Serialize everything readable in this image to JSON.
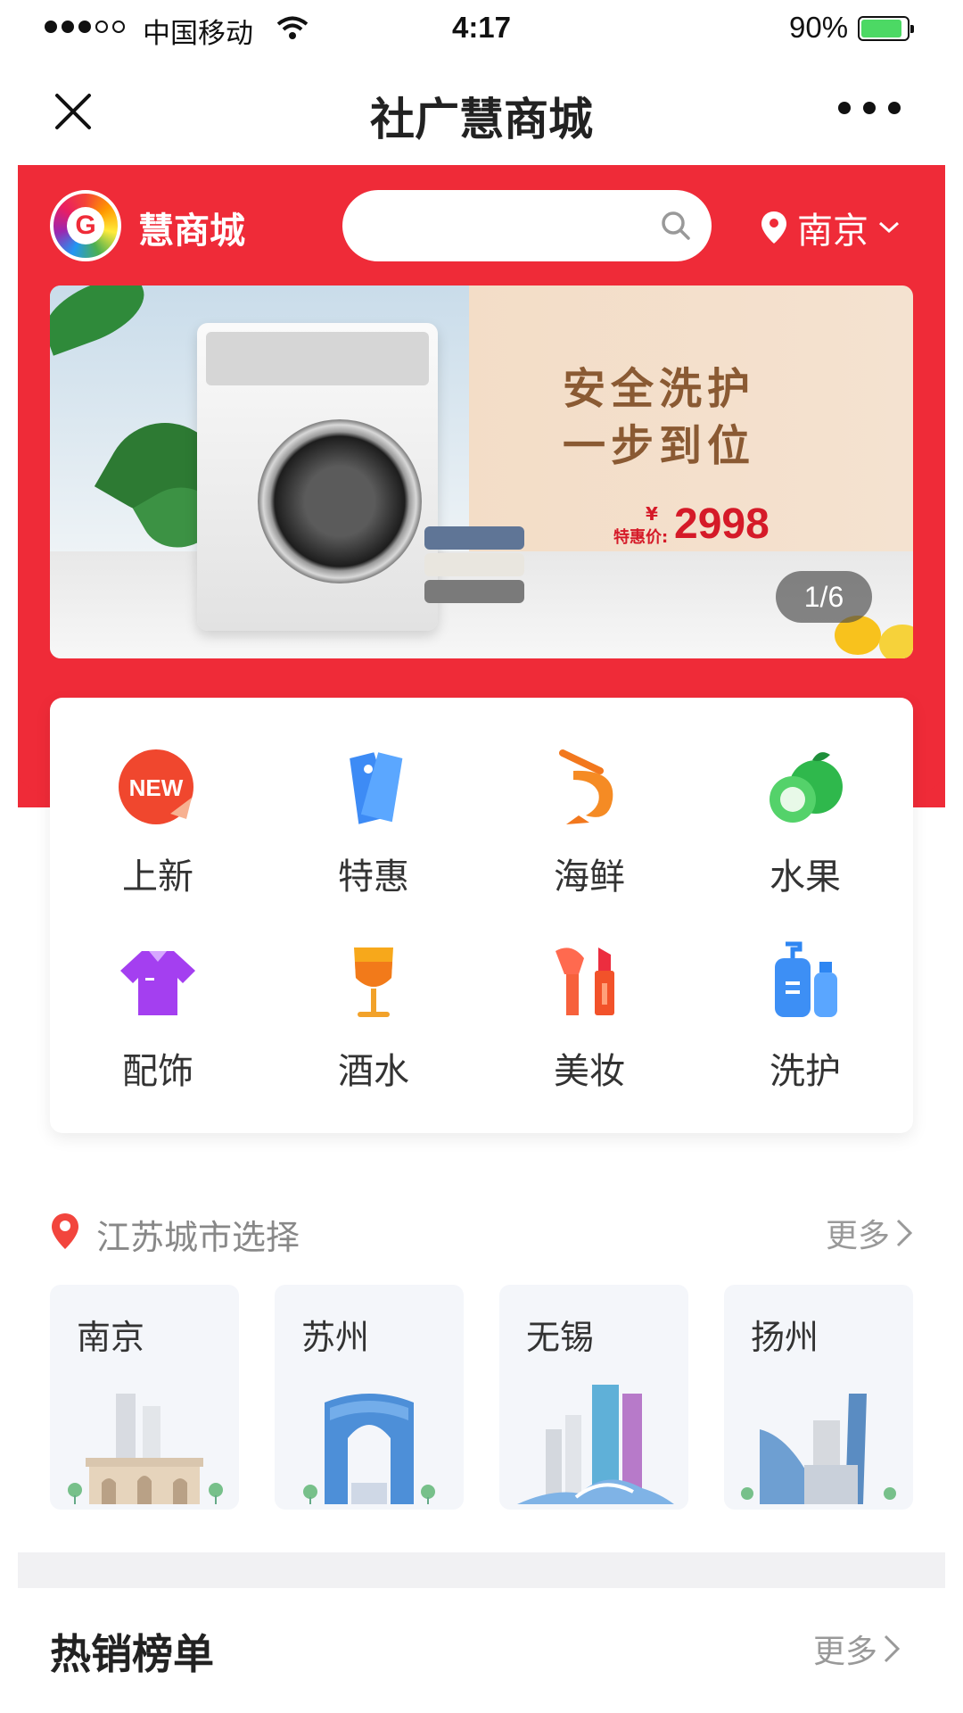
{
  "status_bar": {
    "carrier": "中国移动",
    "time": "4:17",
    "battery": "90%",
    "battery_level": 0.9,
    "signal_bars_filled": 3,
    "signal_bars_total": 5
  },
  "nav": {
    "title": "社广慧商城"
  },
  "header": {
    "brand_logo_letter": "G",
    "brand_name": "慧商城",
    "search_placeholder": "",
    "city": "南京",
    "accent_color": "#ef2b38"
  },
  "banner": {
    "headline_1": "安全洗护",
    "headline_2": "一步到位",
    "price_label": "特惠价:",
    "price_currency": "¥",
    "price": "2998",
    "indicator": "1/6"
  },
  "categories": [
    {
      "label": "上新",
      "icon": "new-badge-icon"
    },
    {
      "label": "特惠",
      "icon": "price-tag-icon"
    },
    {
      "label": "海鲜",
      "icon": "shrimp-icon"
    },
    {
      "label": "水果",
      "icon": "fruit-icon"
    },
    {
      "label": "配饰",
      "icon": "shirt-icon"
    },
    {
      "label": "酒水",
      "icon": "wine-glass-icon"
    },
    {
      "label": "美妆",
      "icon": "lipstick-icon"
    },
    {
      "label": "洗护",
      "icon": "lotion-bottle-icon"
    }
  ],
  "city_section": {
    "title": "江苏城市选择",
    "more": "更多",
    "cities": [
      "南京",
      "苏州",
      "无锡",
      "扬州"
    ]
  },
  "hot_section": {
    "title": "热销榜单",
    "more": "更多"
  }
}
